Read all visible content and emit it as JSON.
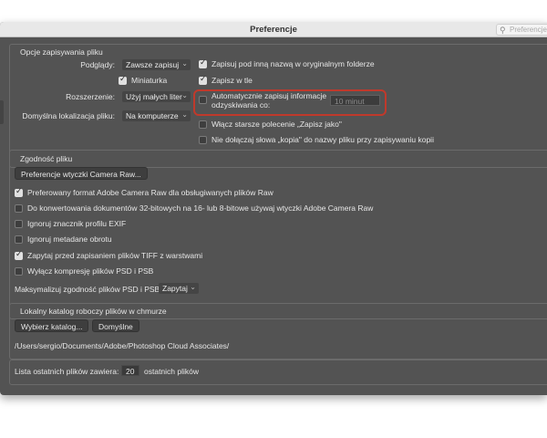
{
  "window": {
    "title": "Preferencje"
  },
  "search": {
    "placeholder": "Preferencje",
    "icon": "search-icon"
  },
  "save_options": {
    "section_title": "Opcje zapisywania pliku",
    "previews_label": "Podglądy:",
    "previews_value": "Zawsze zapisuj",
    "thumbnail_label": "Miniaturka",
    "thumbnail_checked": true,
    "extension_label": "Rozszerzenie:",
    "extension_value": "Użyj małych liter",
    "default_location_label": "Domyślna lokalizacja pliku:",
    "default_location_value": "Na komputerze",
    "save_as_original_folder": {
      "label": "Zapisuj pod inną nazwą w oryginalnym folderze",
      "checked": true
    },
    "save_in_background": {
      "label": "Zapisz w tle",
      "checked": true
    },
    "auto_save_line1": "Automatycznie zapisuj informacje",
    "auto_save_line2": "odzyskiwania co:",
    "auto_save_checked": false,
    "auto_save_interval": "10 minut",
    "legacy_save_as": {
      "label": "Włącz starsze polecenie „Zapisz jako\"",
      "checked": false
    },
    "no_copy_word": {
      "label": "Nie dołączaj słowa „kopia\" do nazwy pliku przy zapisywaniu kopii",
      "checked": false
    }
  },
  "compatibility": {
    "section_title": "Zgodność pliku",
    "camera_raw_button": "Preferencje wtyczki Camera Raw...",
    "options": [
      {
        "label": "Preferowany format Adobe Camera Raw dla obsługiwanych plików Raw",
        "checked": true
      },
      {
        "label": "Do konwertowania dokumentów 32-bitowych na 16- lub 8-bitowe używaj wtyczki Adobe Camera Raw",
        "checked": false
      },
      {
        "label": "Ignoruj znacznik profilu EXIF",
        "checked": false
      },
      {
        "label": "Ignoruj metadane obrotu",
        "checked": false
      },
      {
        "label": "Zapytaj przed zapisaniem plików TIFF z warstwami",
        "checked": true
      },
      {
        "label": "Wyłącz kompresję plików PSD i PSB",
        "checked": false
      }
    ],
    "maximize_label": "Maksymalizuj zgodność plików PSD i PSB:",
    "maximize_value": "Zapytaj"
  },
  "cloud_catalog": {
    "section_title": "Lokalny katalog roboczy plików w chmurze",
    "choose_button": "Wybierz katalog...",
    "default_button": "Domyślne",
    "path": "/Users/sergio/Documents/Adobe/Photoshop Cloud Associates/"
  },
  "recent_files": {
    "label_before": "Lista ostatnich plików zawiera:",
    "value": "20",
    "label_after": "ostatnich plików"
  },
  "colors": {
    "panel_bg": "#535353",
    "highlight": "#c0392b",
    "titlebar": "#e8e8e8"
  }
}
